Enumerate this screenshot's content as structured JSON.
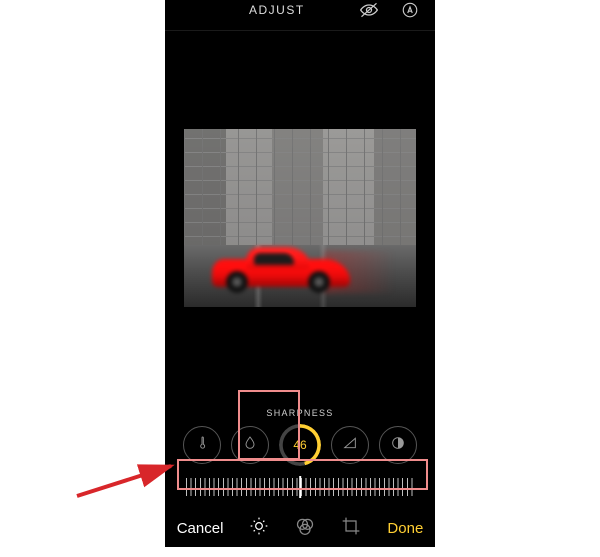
{
  "header": {
    "title": "ADJUST",
    "icon_visibility": "visibility-off-icon",
    "icon_auto": "auto-circle-icon"
  },
  "adjustment": {
    "param_label": "SHARPNESS",
    "value": "46",
    "site_icon_1": "thermometer-icon",
    "site_icon_2": "droplet-icon",
    "site_icon_4": "triangle-icon",
    "site_icon_5": "half-circle-icon"
  },
  "footer": {
    "cancel": "Cancel",
    "done": "Done",
    "icon_adjust": "adjust-sun-icon",
    "icon_filters": "filters-icon",
    "icon_crop": "crop-icon"
  },
  "colors": {
    "accent": "#ffcf33",
    "highlight": "#f08d8d"
  }
}
